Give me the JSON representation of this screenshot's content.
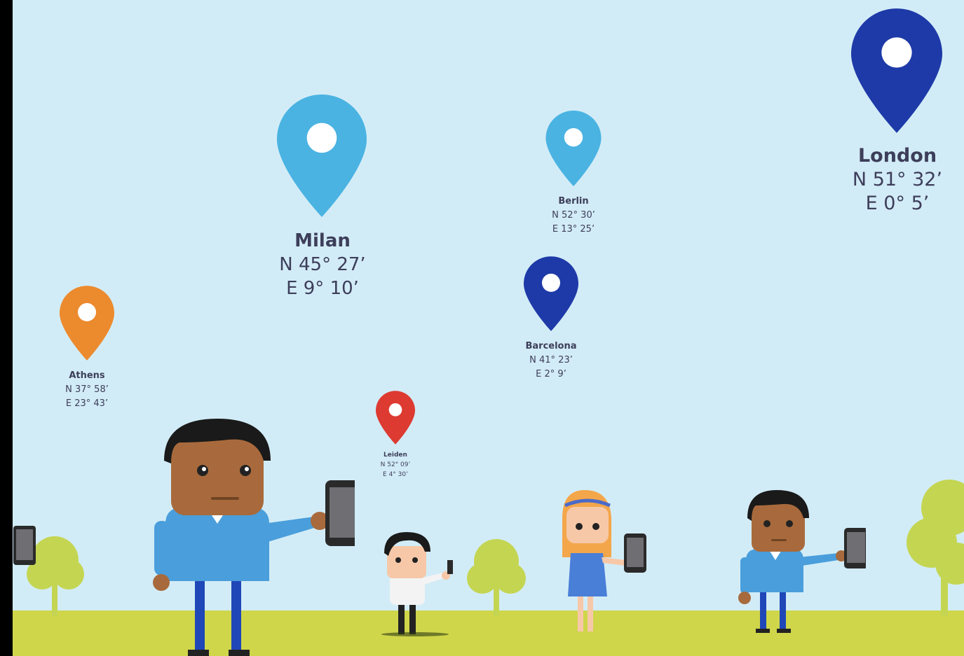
{
  "colors": {
    "sky": "#d2ecf7",
    "ground": "#cfd64a",
    "tree": "#c4d552",
    "pin_light_blue": "#4ab3e2",
    "pin_dark_blue": "#1e3aa8",
    "pin_orange": "#ec8a2e",
    "pin_red": "#dd3a32",
    "label_text": "#3d3e5a"
  },
  "locations": [
    {
      "city": "London",
      "lat": "N 51° 32’",
      "lon": "E 0° 5’",
      "pin_icon": "map-pin-icon",
      "pin_color": "dark-blue"
    },
    {
      "city": "Milan",
      "lat": "N 45° 27’",
      "lon": "E 9° 10’",
      "pin_icon": "map-pin-icon",
      "pin_color": "light-blue"
    },
    {
      "city": "Berlin",
      "lat": "N 52° 30’",
      "lon": "E 13° 25’",
      "pin_icon": "map-pin-icon",
      "pin_color": "light-blue"
    },
    {
      "city": "Barcelona",
      "lat": "N 41° 23’",
      "lon": "E 2° 9’",
      "pin_icon": "map-pin-icon",
      "pin_color": "dark-blue"
    },
    {
      "city": "Athens",
      "lat": "N 37° 58’",
      "lon": "E 23° 43’",
      "pin_icon": "map-pin-icon",
      "pin_color": "orange"
    },
    {
      "city": "Leiden",
      "lat": "N 52° 09’",
      "lon": "E 4° 30’",
      "pin_icon": "map-pin-icon",
      "pin_color": "red"
    }
  ]
}
